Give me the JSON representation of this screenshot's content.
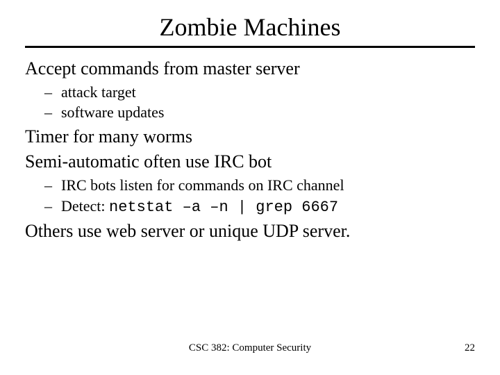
{
  "slide": {
    "title": "Zombie Machines",
    "lines": {
      "l1": "Accept commands from master server",
      "l1a": "attack target",
      "l1b": "software updates",
      "l2": "Timer for many worms",
      "l3": "Semi-automatic often use IRC bot",
      "l3a": "IRC bots listen for commands on IRC channel",
      "l3b_prefix": "Detect: ",
      "l3b_code": "netstat –a –n | grep 6667",
      "l4": "Others use web server or unique UDP server."
    },
    "footer": {
      "course": "CSC 382: Computer Security",
      "page": "22"
    }
  }
}
